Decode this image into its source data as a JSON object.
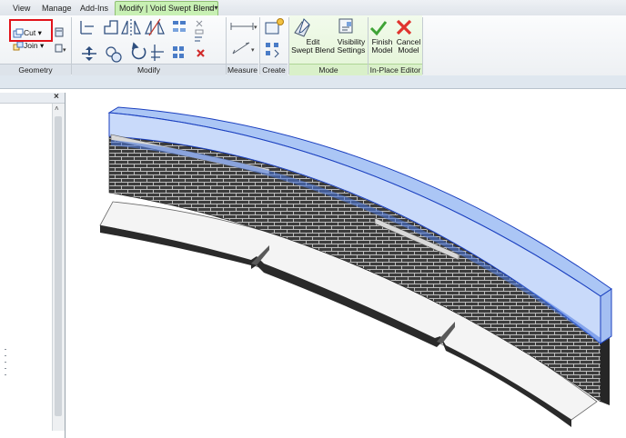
{
  "tabs": [
    {
      "label": "View",
      "active": false
    },
    {
      "label": "Manage",
      "active": false
    },
    {
      "label": "Add-Ins",
      "active": false
    },
    {
      "label": "Modify | Void Swept Blend",
      "active": true
    }
  ],
  "ribbon": {
    "geometry": {
      "cut_label": "Cut",
      "join_label": "Join",
      "panel_label": "Geometry"
    },
    "modify": {
      "panel_label": "Modify"
    },
    "measure": {
      "panel_label": "Measure"
    },
    "create": {
      "panel_label": "Create"
    },
    "mode": {
      "edit_swept_blend": [
        "Edit",
        "Swept Blend"
      ],
      "visibility_settings": [
        "Visibility",
        "Settings"
      ],
      "panel_label": "Mode"
    },
    "inplace": {
      "finish_model": [
        "Finish",
        "Model"
      ],
      "cancel_model": [
        "Cancel",
        "Model"
      ],
      "panel_label": "In-Place Editor"
    }
  },
  "colors": {
    "accent_green": "#c8f0b4",
    "highlight_red": "#e2141b",
    "void_blue": "#8fb3f2"
  }
}
